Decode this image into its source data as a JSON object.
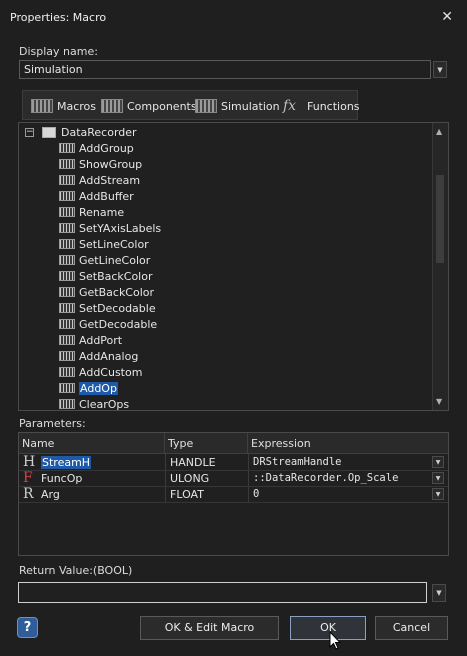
{
  "window": {
    "title": "Properties: Macro"
  },
  "display_name": {
    "label": "Display name:",
    "value": "Simulation"
  },
  "tabs": [
    {
      "label": "Macros",
      "icon": "macro-icon"
    },
    {
      "label": "Components",
      "icon": "component-icon"
    },
    {
      "label": "Simulation",
      "icon": "simulation-icon"
    },
    {
      "label": "Functions",
      "icon": "fx-icon"
    }
  ],
  "tree": {
    "root": "DataRecorder",
    "expander": "−",
    "items": [
      "AddGroup",
      "ShowGroup",
      "AddStream",
      "AddBuffer",
      "Rename",
      "SetYAxisLabels",
      "SetLineColor",
      "GetLineColor",
      "SetBackColor",
      "GetBackColor",
      "SetDecodable",
      "GetDecodable",
      "AddPort",
      "AddAnalog",
      "AddCustom",
      "AddOp",
      "ClearOps"
    ],
    "selected": "AddOp"
  },
  "parameters": {
    "label": "Parameters:",
    "headers": {
      "name": "Name",
      "type": "Type",
      "expression": "Expression"
    },
    "rows": [
      {
        "icon": "H",
        "name": "StreamH",
        "type": "HANDLE",
        "expression": "DRStreamHandle"
      },
      {
        "icon": "F",
        "name": "FuncOp",
        "type": "ULONG",
        "expression": "::DataRecorder.Op_Scale"
      },
      {
        "icon": "R",
        "name": "Arg",
        "type": "FLOAT",
        "expression": "0"
      }
    ]
  },
  "return_value": {
    "label": "Return Value:(BOOL)",
    "value": ""
  },
  "buttons": {
    "help": "?",
    "ok_edit": "OK & Edit Macro",
    "ok": "OK",
    "cancel": "Cancel"
  }
}
